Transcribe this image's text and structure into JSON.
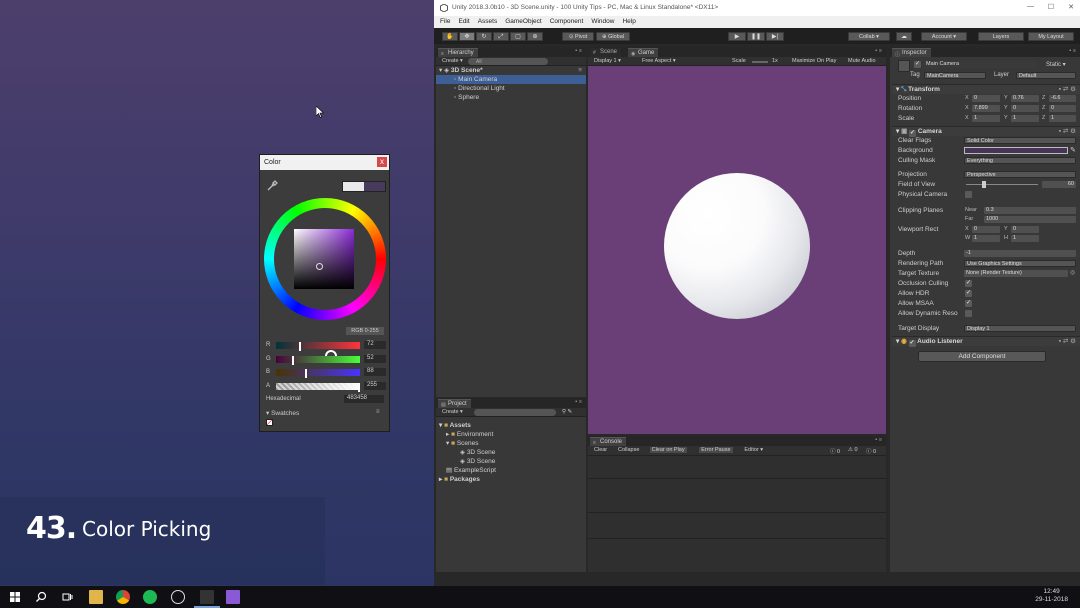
{
  "caption": {
    "number": "43.",
    "text": "Color Picking"
  },
  "color_picker": {
    "title": "Color",
    "close": "x",
    "mode": "RGB 0-255",
    "channels": [
      {
        "label": "R",
        "value": "72",
        "fraction": 0.28,
        "gradient": "linear-gradient(90deg,#00343a,#ff343a)"
      },
      {
        "label": "G",
        "value": "52",
        "fraction": 0.2,
        "gradient": "linear-gradient(90deg,#48003a,#48ff3a)"
      },
      {
        "label": "B",
        "value": "88",
        "fraction": 0.35,
        "gradient": "linear-gradient(90deg,#483400,#4834ff)"
      },
      {
        "label": "A",
        "value": "255",
        "fraction": 1.0,
        "gradient": "linear-gradient(90deg,#555,#eee)"
      }
    ],
    "hex_label": "Hexadecimal",
    "hex_value": "483458",
    "swatches_label": "Swatches",
    "swatches_menu": "≡"
  },
  "unity": {
    "title": "Unity 2018.3.0b10 - 3D Scene.unity - 100 Unity Tips - PC, Mac & Linux Standalone* <DX11>",
    "window_controls": [
      "—",
      "☐",
      "✕"
    ],
    "menu": [
      "File",
      "Edit",
      "Assets",
      "GameObject",
      "Component",
      "Window",
      "Help"
    ],
    "toolbar": {
      "pivot": "Pivot",
      "global": "Global",
      "collab": "Collab ▾",
      "account": "Account ▾",
      "layers": "Layers",
      "layout": "My Layout"
    },
    "hierarchy": {
      "tab": "Hierarchy",
      "create": "Create ▾",
      "search_placeholder": "All",
      "scene": "3D Scene*",
      "items": [
        "Main Camera",
        "Directional Light",
        "Sphere"
      ]
    },
    "scene_tab": "Scene",
    "game_tab": "Game",
    "game_bar": {
      "display": "Display 1 ▾",
      "aspect": "Free Aspect ▾",
      "scale_label": "Scale",
      "scale_value": "1x",
      "maximize": "Maximize On Play",
      "mute": "Mute Audio",
      "stats": "Stats",
      "gizmos": "Gizmos ▾"
    },
    "project": {
      "tab": "Project",
      "create": "Create ▾",
      "assets": "Assets",
      "items": [
        {
          "label": "Environment",
          "level": 1,
          "type": "folder"
        },
        {
          "label": "Scenes",
          "level": 1,
          "type": "folder"
        },
        {
          "label": "3D Scene",
          "level": 2,
          "type": "scene"
        },
        {
          "label": "3D Scene",
          "level": 2,
          "type": "scene"
        },
        {
          "label": "ExampleScript",
          "level": 1,
          "type": "script"
        }
      ],
      "packages": "Packages"
    },
    "console": {
      "tab": "Console",
      "buttons": [
        "Clear",
        "Collapse",
        "Clear on Play",
        "Error Pause",
        "Editor ▾"
      ],
      "counts": [
        "0",
        "0",
        "0"
      ]
    },
    "inspector": {
      "tab": "Inspector",
      "object_name": "Main Camera",
      "static": "Static ▾",
      "tag_label": "Tag",
      "tag_value": "MainCamera",
      "layer_label": "Layer",
      "layer_value": "Default",
      "transform": {
        "title": "Transform",
        "rows": [
          {
            "label": "Position",
            "x": "0",
            "y": "0.76",
            "z": "-6.6"
          },
          {
            "label": "Rotation",
            "x": "7.899",
            "y": "0",
            "z": "0"
          },
          {
            "label": "Scale",
            "x": "1",
            "y": "1",
            "z": "1"
          }
        ]
      },
      "camera": {
        "title": "Camera",
        "clear_flags_label": "Clear Flags",
        "clear_flags": "Solid Color",
        "background_label": "Background",
        "culling_label": "Culling Mask",
        "culling": "Everything",
        "projection_label": "Projection",
        "projection": "Perspective",
        "fov_label": "Field of View",
        "fov": "60",
        "physical_label": "Physical Camera",
        "clipping_label": "Clipping Planes",
        "near_label": "Near",
        "near": "0.3",
        "far_label": "Far",
        "far": "1000",
        "viewport_label": "Viewport Rect",
        "vx": "0",
        "vy": "0",
        "vw": "1",
        "vh": "1",
        "depth_label": "Depth",
        "depth": "-1",
        "rendering_label": "Rendering Path",
        "rendering": "Use Graphics Settings",
        "target_tex_label": "Target Texture",
        "target_tex": "None (Render Texture)",
        "occlusion_label": "Occlusion Culling",
        "hdr_label": "Allow HDR",
        "msaa_label": "Allow MSAA",
        "dynres_label": "Allow Dynamic Reso",
        "target_display_label": "Target Display",
        "target_display": "Display 1"
      },
      "audio_listener": "Audio Listener",
      "add_component": "Add Component"
    }
  },
  "taskbar": {
    "time": "12:49",
    "date": "29-11-2018"
  },
  "colors": {
    "game_bg": "#6a3e77",
    "selection": "#3e5f96",
    "picked": "#483458"
  }
}
